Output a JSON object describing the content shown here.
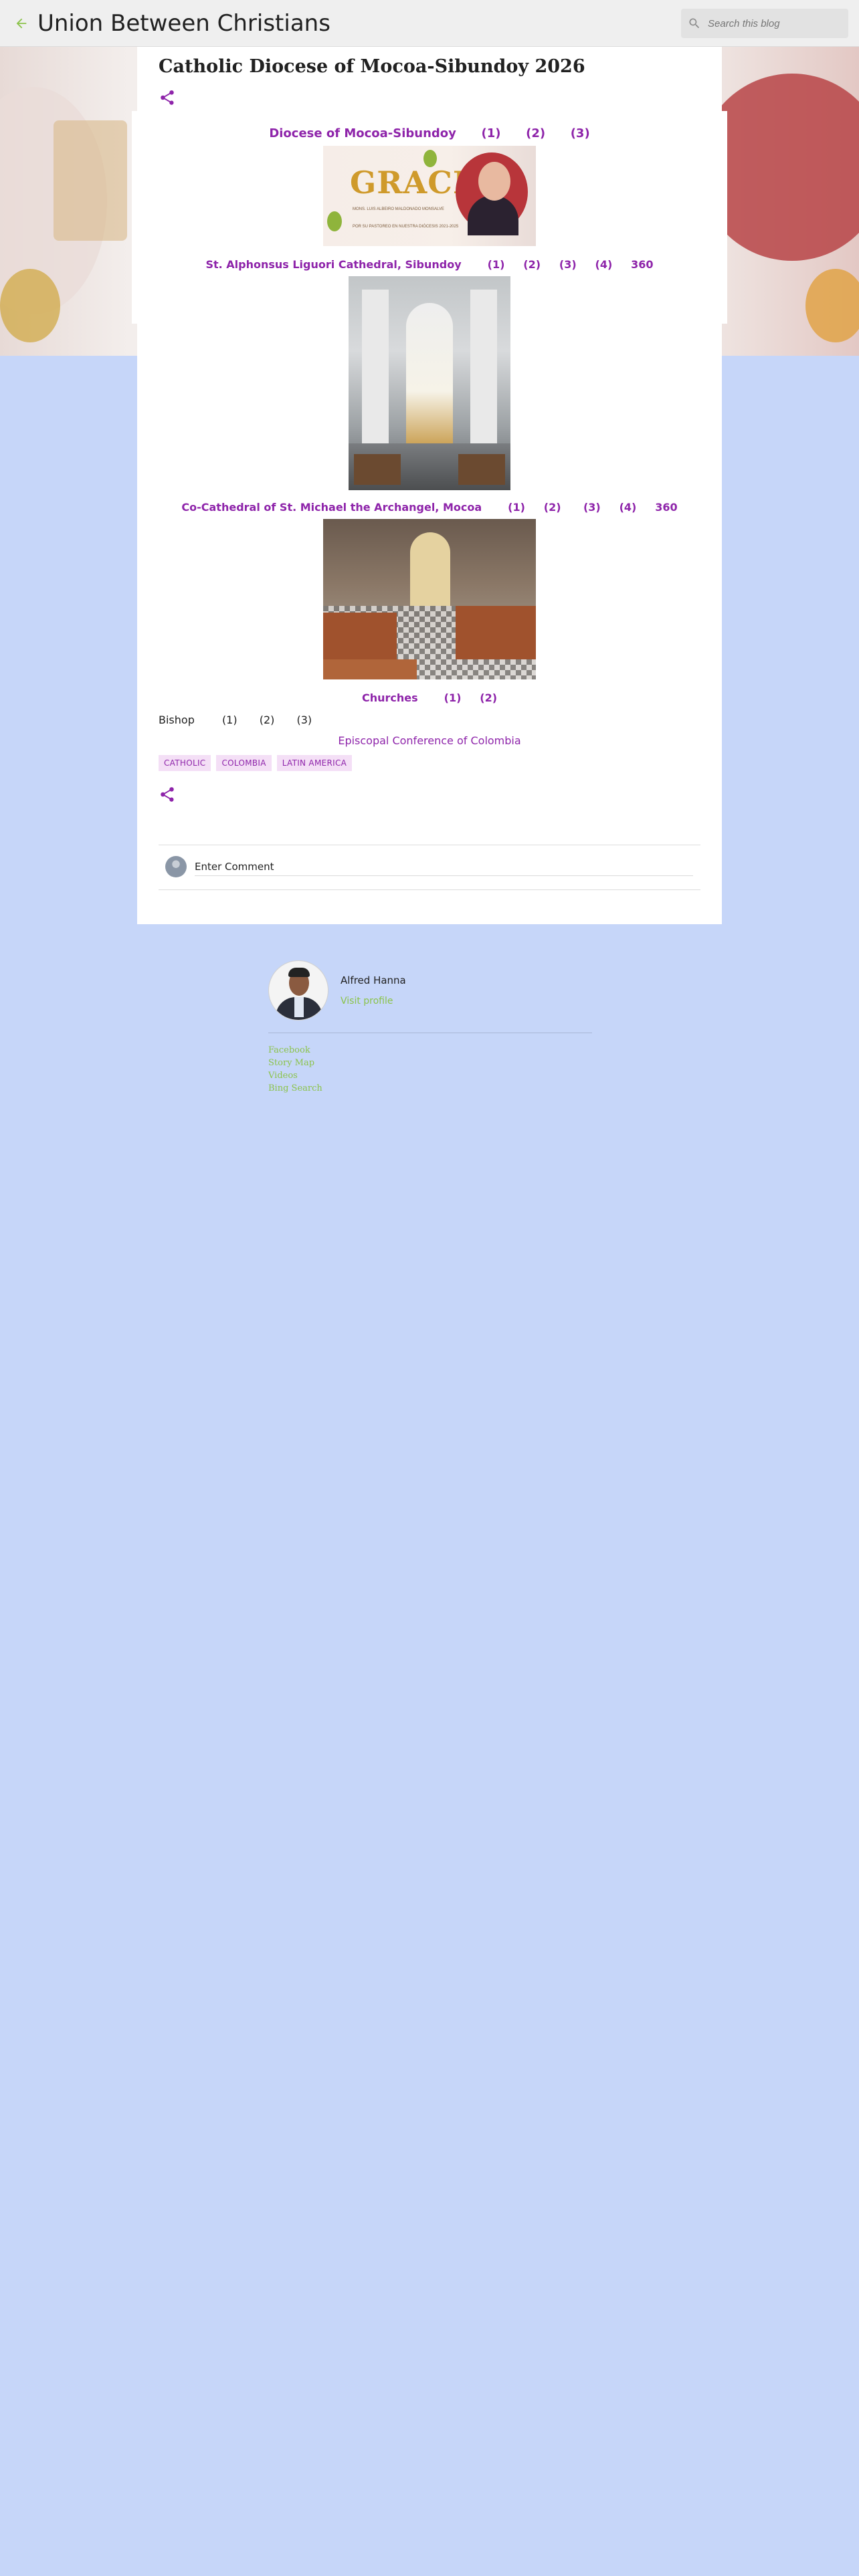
{
  "header": {
    "blog_title": "Union Between Christians",
    "search_placeholder": "Search this blog"
  },
  "colors": {
    "accent": "#8e24aa",
    "link_green": "#8bc34a",
    "background": "#c6d6f9"
  },
  "post": {
    "title": "Catholic Diocese of Mocoa-Sibundoy 2026",
    "section1": {
      "title": "Diocese of Mocoa-Sibundoy",
      "links": [
        "(1)",
        "(2)",
        "(3)"
      ]
    },
    "image1": {
      "caption_word": "GRACIAS",
      "line1": "MONS. LUIS ALBEIRO MALDONADO MONSALVE",
      "line2": "POR SU PASTOREO EN NUESTRA DIÓCESIS 2021-2025"
    },
    "section2": {
      "title": "St. Alphonsus Liguori Cathedral, Sibundoy",
      "links": [
        "(1)",
        "(2)",
        "(3)",
        "(4)",
        "360"
      ]
    },
    "section3": {
      "title": "Co-Cathedral of St. Michael the Archangel, Mocoa",
      "links": [
        "(1)",
        "(2)",
        "(3)",
        "(4)",
        "360"
      ]
    },
    "section4": {
      "title": "Churches",
      "links": [
        "(1)",
        "(2)"
      ]
    },
    "bishop": {
      "label": "Bishop",
      "links": [
        "(1)",
        "(2)",
        "(3)"
      ]
    },
    "episcopal_link": "Episcopal Conference of Colombia",
    "labels": [
      "CATHOLIC",
      "COLOMBIA",
      "LATIN AMERICA"
    ],
    "comment_placeholder": "Enter Comment"
  },
  "profile": {
    "name": "Alfred Hanna",
    "visit_label": "Visit profile",
    "links": [
      "Facebook",
      "Story Map",
      "Videos",
      "Bing Search"
    ]
  }
}
